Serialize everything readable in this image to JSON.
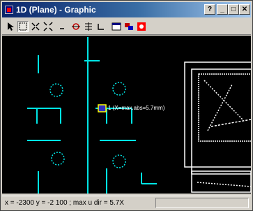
{
  "window": {
    "title": "1D (Plane) - Graphic",
    "title_icon": "app-icon",
    "help_glyph": "?",
    "min_glyph": "_",
    "max_glyph": "□",
    "close_glyph": "✕"
  },
  "toolbar": {
    "tools": [
      {
        "name": "select-arrow-icon"
      },
      {
        "name": "zoom-window-icon",
        "pressed": true
      },
      {
        "name": "zoom-in-icon"
      },
      {
        "name": "zoom-out-icon"
      },
      {
        "name": "pan-line-icon"
      },
      {
        "name": "target-icon"
      },
      {
        "name": "snap-icon"
      },
      {
        "name": "measure-icon"
      },
      {
        "name": "window-icon"
      },
      {
        "name": "layers-icon"
      },
      {
        "name": "plot-icon"
      }
    ]
  },
  "canvas": {
    "label_text": "1 (X=max.abs=5.7mm)"
  },
  "status": {
    "text": "x = -2300 y = -2 100 ; max u dir = 5.7X"
  },
  "colors": {
    "title_start": "#0a246a",
    "title_end": "#a6caf0",
    "canvas_bg": "#000000",
    "structure": "#00e5e5",
    "outline": "#ffffff",
    "marker_fill": "#3030c0",
    "marker_border": "#ffff00"
  }
}
